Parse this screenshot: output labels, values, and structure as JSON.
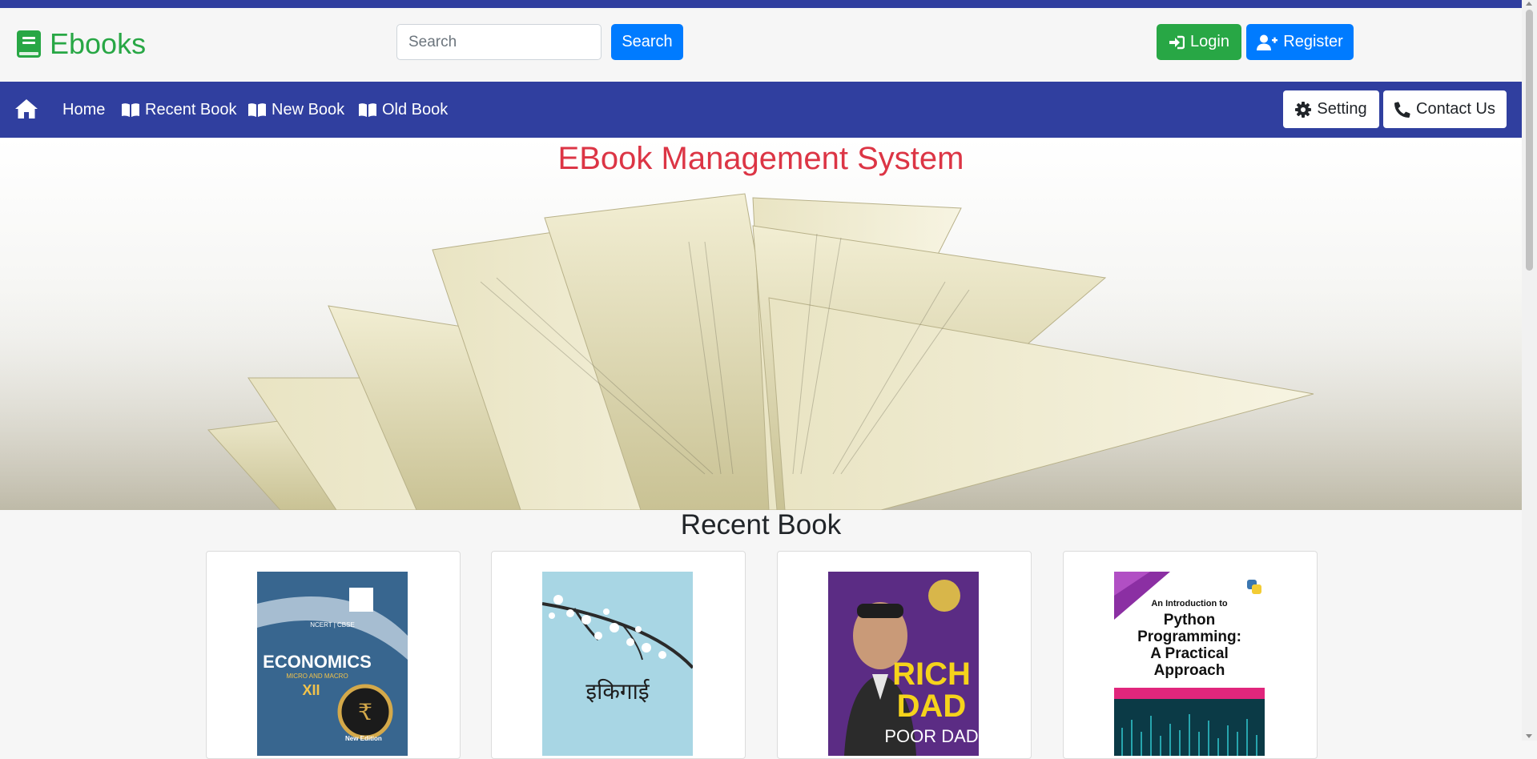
{
  "brand": {
    "name": "Ebooks",
    "icon": "book-icon",
    "color": "#28a745"
  },
  "search": {
    "placeholder": "Search",
    "value": "",
    "button_label": "Search"
  },
  "auth": {
    "login_label": "Login",
    "register_label": "Register"
  },
  "nav": {
    "home_icon": "home-icon",
    "items": [
      {
        "label": "Home"
      },
      {
        "label": "Recent Book",
        "icon": "open-book-icon"
      },
      {
        "label": "New Book",
        "icon": "open-book-icon"
      },
      {
        "label": "Old Book",
        "icon": "open-book-icon"
      }
    ],
    "setting_label": "Setting",
    "contact_label": "Contact Us"
  },
  "hero": {
    "title": "EBook Management System"
  },
  "recent": {
    "title": "Recent Book",
    "books": [
      {
        "cover_lines": [
          "NCERT | CBSE",
          "ECONOMICS",
          "MICRO AND MACRO",
          "XII",
          "New Edition"
        ]
      },
      {
        "cover_lines": [
          "इकिगाई"
        ]
      },
      {
        "cover_lines": [
          "RICH",
          "DAD",
          "POOR DAD"
        ]
      },
      {
        "cover_lines": [
          "An Introduction to",
          "Python",
          "Programming:",
          "A Practical",
          "Approach"
        ]
      }
    ]
  },
  "colors": {
    "primary": "#007bff",
    "success": "#28a745",
    "navbar": "#303f9f",
    "title_red": "#dc3545"
  }
}
